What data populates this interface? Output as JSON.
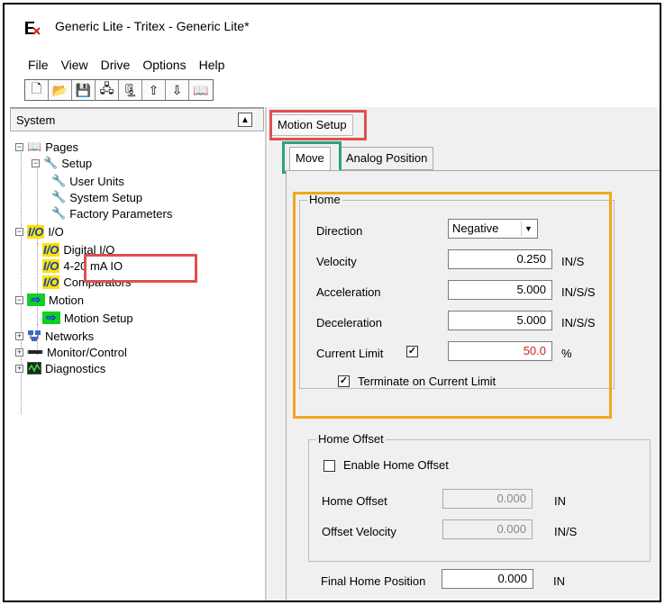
{
  "window": {
    "title": "Generic Lite - Tritex - Generic Lite*"
  },
  "menu": [
    "File",
    "View",
    "Drive",
    "Options",
    "Help"
  ],
  "toolbar": {
    "buttons": [
      {
        "icon": "new-file-icon",
        "glyph": "🗋"
      },
      {
        "icon": "open-folder-icon",
        "glyph": "📂"
      },
      {
        "icon": "save-icon",
        "glyph": "💾"
      },
      {
        "icon": "network-icon",
        "glyph": "🖧"
      },
      {
        "icon": "network-tree-icon",
        "glyph": "🗜"
      },
      {
        "icon": "upload-arrow-icon",
        "glyph": "⇧"
      },
      {
        "icon": "download-arrow-icon",
        "glyph": "⇩"
      },
      {
        "icon": "book-icon",
        "glyph": "📖"
      }
    ]
  },
  "left": {
    "header": "System",
    "tree": [
      {
        "label": "Pages",
        "icon": "book-icon"
      },
      {
        "label": "Setup",
        "icon": "wrench-icon"
      },
      {
        "label": "User Units",
        "icon": "wrench-icon"
      },
      {
        "label": "System Setup",
        "icon": "wrench-icon"
      },
      {
        "label": "Factory Parameters",
        "icon": "wrench-icon"
      },
      {
        "label": "I/O",
        "icon": "io-icon"
      },
      {
        "label": "Digital I/O",
        "icon": "io-icon"
      },
      {
        "label": "4-20 mA IO",
        "icon": "io-icon"
      },
      {
        "label": "Comparators",
        "icon": "io-icon"
      },
      {
        "label": "Motion",
        "icon": "motion-arrow-icon"
      },
      {
        "label": "Motion Setup",
        "icon": "motion-arrow-icon"
      },
      {
        "label": "Networks",
        "icon": "network-icon"
      },
      {
        "label": "Monitor/Control",
        "icon": "monitor-icon"
      },
      {
        "label": "Diagnostics",
        "icon": "diagnostics-icon"
      }
    ],
    "io_glyph": "I/O",
    "book_glyph": "📖",
    "wrench_glyph": "🔧",
    "arrow_glyph": "⇨",
    "expand_minus": "−",
    "expand_plus": "+"
  },
  "right": {
    "page_tab": "Motion Setup",
    "tabs": [
      "Move",
      "Analog Position"
    ],
    "home": {
      "legend": "Home",
      "direction_label": "Direction",
      "direction_value": "Negative",
      "velocity_label": "Velocity",
      "velocity_value": "0.250",
      "velocity_unit": "IN/S",
      "accel_label": "Acceleration",
      "accel_value": "5.000",
      "accel_unit": "IN/S/S",
      "decel_label": "Deceleration",
      "decel_value": "5.000",
      "decel_unit": "IN/S/S",
      "current_label": "Current Limit",
      "current_checked": true,
      "current_value": "50.0",
      "current_unit": "%",
      "terminate_label": "Terminate on Current Limit",
      "terminate_checked": true
    },
    "offset": {
      "legend": "Home Offset",
      "enable_label": "Enable Home Offset",
      "enable_checked": false,
      "offset_label": "Home Offset",
      "offset_value": "0.000",
      "offset_unit": "IN",
      "velocity_label": "Offset Velocity",
      "velocity_value": "0.000",
      "velocity_unit": "IN/S"
    },
    "final": {
      "label": "Final Home Position",
      "value": "0.000",
      "unit": "IN"
    }
  },
  "colors": {
    "highlight_red": "#e05050",
    "highlight_teal": "#2aa37e",
    "highlight_orange": "#f2a81a"
  }
}
